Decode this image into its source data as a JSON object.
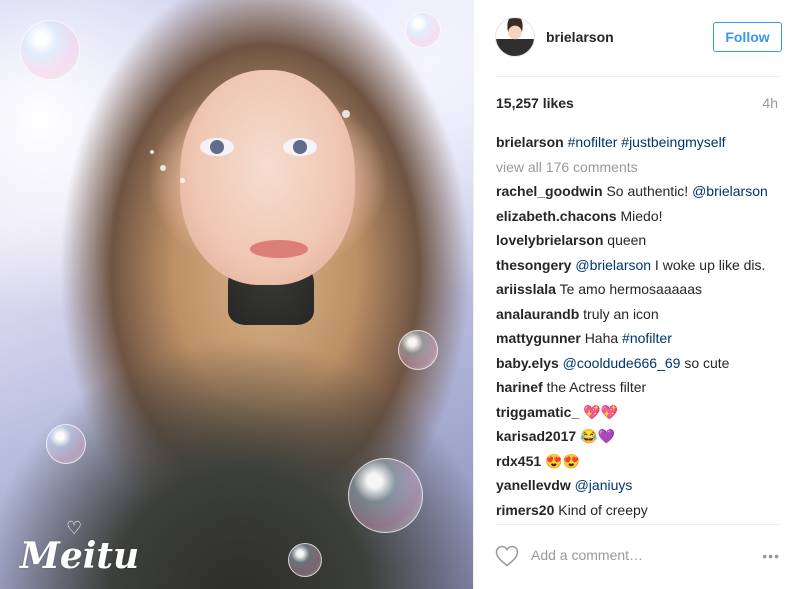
{
  "post": {
    "watermark": "Meitu"
  },
  "header": {
    "username": "brielarson",
    "follow_label": "Follow"
  },
  "stats": {
    "likes": "15,257 likes",
    "time_ago": "4h"
  },
  "caption": {
    "user": "brielarson",
    "text": "#nofilter #justbeingmyself"
  },
  "view_all": "view all 176 comments",
  "comments": [
    {
      "user": "rachel_goodwin",
      "text": "So authentic! ",
      "tag": "@brielarson",
      "after": ""
    },
    {
      "user": "elizabeth.chacons",
      "text": "Miedo!",
      "tag": "",
      "after": ""
    },
    {
      "user": "lovelybrielarson",
      "text": "queen",
      "tag": "",
      "after": ""
    },
    {
      "user": "thesongery",
      "text": "",
      "tag": "@brielarson",
      "after": " I woke up like dis."
    },
    {
      "user": "ariisslala",
      "text": "Te amo hermosaaaaas",
      "tag": "",
      "after": ""
    },
    {
      "user": "analaurandb",
      "text": "truly an icon",
      "tag": "",
      "after": ""
    },
    {
      "user": "mattygunner",
      "text": "Haha ",
      "tag": "#nofilter",
      "after": ""
    },
    {
      "user": "baby.elys",
      "text": "",
      "tag": "@cooldude666_69",
      "after": " so cute"
    },
    {
      "user": "harinef",
      "text": "the Actress filter",
      "tag": "",
      "after": ""
    },
    {
      "user": "triggamatic_",
      "text": "💖💖",
      "tag": "",
      "after": ""
    },
    {
      "user": "karisad2017",
      "text": "😂💜",
      "tag": "",
      "after": ""
    },
    {
      "user": "rdx451",
      "text": "😍😍",
      "tag": "",
      "after": ""
    },
    {
      "user": "yanellevdw",
      "text": "",
      "tag": "@janiuys",
      "after": ""
    },
    {
      "user": "rimers20",
      "text": "Kind of creepy",
      "tag": "",
      "after": ""
    }
  ],
  "add_comment": {
    "placeholder": "Add a comment…",
    "more": "•••"
  },
  "colors": {
    "accent": "#3897f0",
    "tag": "#003569",
    "muted": "#999999",
    "text": "#262626"
  }
}
